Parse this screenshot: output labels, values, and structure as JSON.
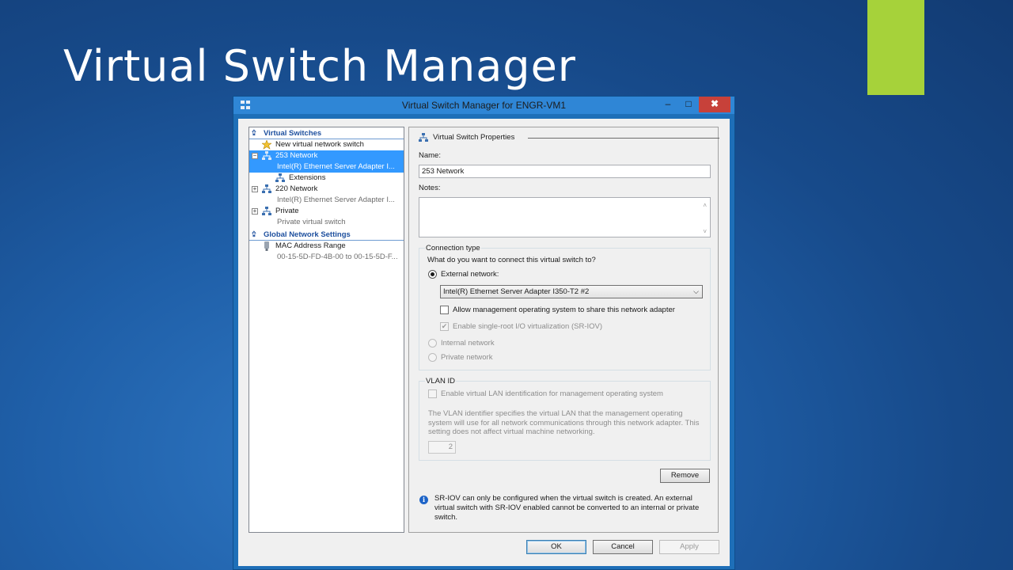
{
  "slide": {
    "title": "Virtual Switch Manager"
  },
  "window": {
    "title": "Virtual Switch Manager for ENGR-VM1",
    "min_label": "–",
    "max_label": "□",
    "close_label": "✖"
  },
  "tree": {
    "virtual_switches_header": "Virtual Switches",
    "new_switch": "New virtual network switch",
    "switches": [
      {
        "name": "253 Network",
        "sub": "Intel(R) Ethernet Server Adapter I..."
      },
      {
        "name": "Extensions"
      },
      {
        "name": "220 Network",
        "sub": "Intel(R) Ethernet Server Adapter I..."
      },
      {
        "name": "Private",
        "sub": "Private virtual switch"
      }
    ],
    "global_header": "Global Network Settings",
    "mac_range": "MAC Address Range",
    "mac_sub": "00-15-5D-FD-4B-00 to 00-15-5D-F..."
  },
  "props": {
    "header": "Virtual Switch Properties",
    "name_label": "Name:",
    "name_value": "253 Network",
    "notes_label": "Notes:",
    "notes_value": "",
    "connection": {
      "title": "Connection type",
      "question": "What do you want to connect this virtual switch to?",
      "external_label": "External network:",
      "adapter_value": "Intel(R) Ethernet Server Adapter I350-T2 #2",
      "allow_mgmt_label": "Allow management operating system to share this network adapter",
      "sriov_label": "Enable single-root I/O virtualization (SR-IOV)",
      "internal_label": "Internal network",
      "private_label": "Private network"
    },
    "vlan": {
      "title": "VLAN ID",
      "enable_label": "Enable virtual LAN identification for management operating system",
      "description": "The VLAN identifier specifies the virtual LAN that the management operating system will use for all network communications through this network adapter. This setting does not affect virtual machine networking.",
      "value": "2"
    },
    "remove_label": "Remove",
    "info_text": "SR-IOV can only be configured when the virtual switch is created. An external virtual switch with SR-IOV enabled cannot be converted to an internal or private switch."
  },
  "buttons": {
    "ok": "OK",
    "cancel": "Cancel",
    "apply": "Apply"
  },
  "colors": {
    "accent_bar": "#a6d23a",
    "selection": "#3399ff",
    "close_button": "#c7413a"
  }
}
